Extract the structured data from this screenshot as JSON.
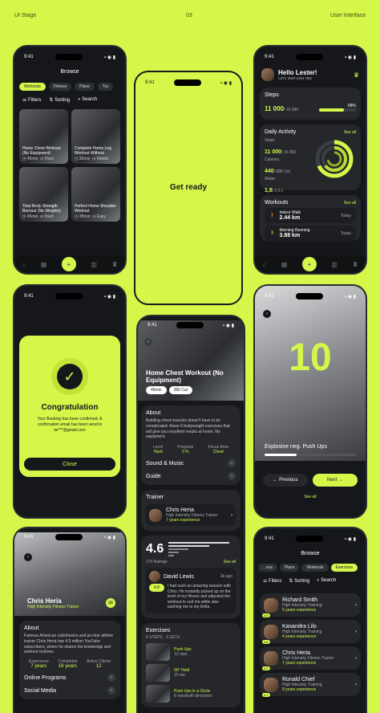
{
  "header": {
    "left": "UI Stage",
    "center": "03",
    "right": "User Interface"
  },
  "status": {
    "time": "9:41"
  },
  "browse": {
    "title": "Browse",
    "tabs": [
      "Workouts",
      "Fitness",
      "Plans",
      "Tra"
    ],
    "filters": "Filters",
    "sorting": "Sorting",
    "search": "Search",
    "items": [
      {
        "title": "Home Chest Workout (No Equipment)",
        "dur": "45min",
        "lvl": "Hard"
      },
      {
        "title": "Complete Home Leg Workout Without",
        "dur": "35min",
        "lvl": "Middle"
      },
      {
        "title": "Total Body Strength Burnout (No Weights)",
        "dur": "45min",
        "lvl": "Hard"
      },
      {
        "title": "Perfect Home Shoulder Workout",
        "dur": "28min",
        "lvl": "Easy"
      }
    ]
  },
  "getready": {
    "title": "Get ready"
  },
  "dash": {
    "greet": "Hello Lester!",
    "sub": "Let's start your day",
    "steps_label": "Steps",
    "steps_val": "11 000",
    "steps_of": "/ 16 000",
    "steps_pct": "68%",
    "activity": "Daily Activity",
    "see_all": "See all",
    "s_label": "Steps",
    "s_val": "11 000",
    "s_of": "/ 16 000",
    "cal_label": "Calories",
    "cal_val": "440",
    "cal_of": "/ 680 Cal",
    "water_label": "Water",
    "water_val": "1,8",
    "water_of": "/ 2,5 L",
    "workouts": "Workouts",
    "w": [
      {
        "name": "Indoor Walk",
        "dist": "2.44 km",
        "day": "Today"
      },
      {
        "name": "Morning Running",
        "dist": "3.88 km",
        "day": "Today"
      }
    ]
  },
  "congrats": {
    "title": "Congratulation",
    "msg": "Your Booking has been confirmed. A confirmation email has been send to ler***@gmail.com",
    "close": "Close"
  },
  "detail": {
    "title": "Home Chest Workout (No Equipment)",
    "time": "45min",
    "cal": "380 Cal",
    "about": "About",
    "about_text": "Building chest muscles doesn't have to be complicated. these 6 bodyweight exercises that will give you excellent results at home. No equipment.",
    "lvl_l": "Level",
    "lvl": "Hard",
    "prog_l": "Progress",
    "prog": "0 %",
    "focus_l": "Focus Area",
    "focus": "Chest",
    "sound": "Sound & Music",
    "guide": "Guide",
    "trainer": "Trainer",
    "tr_name": "Chris Heria",
    "tr_role": "High Intensity Fitness Trainer",
    "tr_exp": "7 years experience",
    "rating": "4.6",
    "ratings": "174 Ratings",
    "see_all": "See all",
    "rv_name": "David Lewis",
    "rv_ago": "3d ago",
    "rv_score": "4.8",
    "rv_text": "I had such an amazing session with Chris. He instantly picked up on the level of my fitness and adjusted the workout to suit me while also pushing me to my limits.",
    "ex": "Exercises",
    "ex_meta": "6 STEPS · 3 SETS",
    "exercises": [
      {
        "name": "Push Ups",
        "meta": "12 reps"
      },
      {
        "name": "90° Hold",
        "meta": "15 sec"
      },
      {
        "name": "Push Ups in a Circle",
        "meta": "8 reps/both directions"
      }
    ]
  },
  "timer": {
    "count": "10",
    "label": "Explosive neg. Push Ups",
    "prev": "← Previous",
    "next": "Next →",
    "see_all": "See all"
  },
  "profile": {
    "name": "Chris Heria",
    "role": "High Intensity Fitness Trainer",
    "about": "About",
    "about_text": "Famous American calisthenics and pro-bar athlete trainer Chris Heria has 4.5 million YouTube subscribers, where he shares his knowledge and workout routines.",
    "exp_l": "Experience",
    "exp": "7 years",
    "comp_l": "Completed",
    "comp": "18 years",
    "cli_l": "Active Clients",
    "cli": "12",
    "online": "Online Programs",
    "social": "Social Media"
  },
  "browse2": {
    "title": "Browse",
    "tabs": [
      "...ess",
      "Plans",
      "Workouts",
      "Exercises"
    ],
    "filters": "Filters",
    "sorting": "Sorting",
    "search": "Search",
    "trainers": [
      {
        "name": "Richard Smith",
        "role": "High Intensity Training",
        "exp": "5 years experience",
        "r": "4.8"
      },
      {
        "name": "Kasandra Lilo",
        "role": "High Intensity Training",
        "exp": "4 years experience",
        "r": "4.6"
      },
      {
        "name": "Chris Heria",
        "role": "High Intensity Fitness Trainer",
        "exp": "7 years experience",
        "r": "4.9"
      },
      {
        "name": "Ronald Chief",
        "role": "High Intensity Training",
        "exp": "9 years experience",
        "r": "4.7"
      }
    ]
  }
}
